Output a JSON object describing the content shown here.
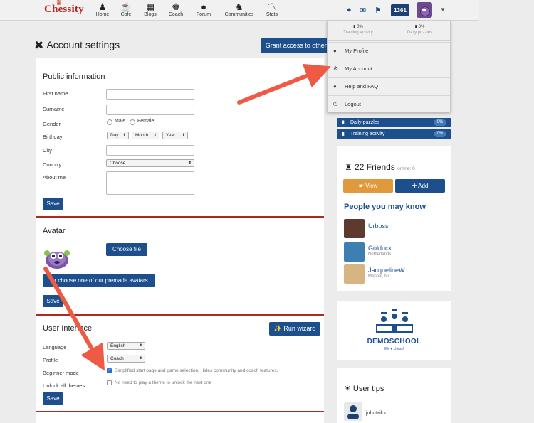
{
  "nav": {
    "logo": "Chessity",
    "items": [
      {
        "label": "Home"
      },
      {
        "label": "Cafe"
      },
      {
        "label": "Blogs"
      },
      {
        "label": "Coach"
      },
      {
        "label": "Forum"
      },
      {
        "label": "Communities"
      },
      {
        "label": "Stats"
      }
    ],
    "rating": "1361"
  },
  "page": {
    "title": "Account settings",
    "grant_button": "Grant access to other accounts"
  },
  "public_info": {
    "title": "Public information",
    "first_name_label": "First name",
    "surname_label": "Surname",
    "gender_label": "Gender",
    "gender_male": "Male",
    "gender_female": "Female",
    "birthday_label": "Birthday",
    "day": "Day",
    "month": "Month",
    "year": "Year",
    "city_label": "City",
    "country_label": "Country",
    "country_value": "Choose",
    "about_label": "About me",
    "save": "Save"
  },
  "avatar": {
    "title": "Avatar",
    "choose_file": "Choose file",
    "premade": "Or choose one of our premade avatars",
    "save": "Save"
  },
  "ui": {
    "title": "User Interface",
    "run_wizard": "Run wizard",
    "language_label": "Language",
    "language_value": "English",
    "profile_label": "Profile",
    "profile_value": "Coach",
    "beginner_label": "Beginner mode",
    "beginner_text": "Simplified start page and game selection. Hides community and coach features.",
    "beginner_checked": true,
    "unlock_label": "Unlock all themes",
    "unlock_text": "No need to play a theme to unlock the next one",
    "unlock_checked": false,
    "save": "Save"
  },
  "dropdown": {
    "training_pct": "0%",
    "training_label": "Training activity",
    "puzzles_pct": "0%",
    "puzzles_label": "Daily puzzles",
    "items": [
      {
        "label": "My Profile"
      },
      {
        "label": "My Account"
      },
      {
        "label": "Help and FAQ"
      },
      {
        "label": "Logout"
      }
    ]
  },
  "sidebar": {
    "stats": [
      {
        "label": "Daily puzzles",
        "pct": "0%"
      },
      {
        "label": "Training activity",
        "pct": "0%"
      }
    ],
    "friends_count": "22 Friends",
    "online": "online: 0",
    "view": "View",
    "add": "Add",
    "pymk_title": "People you may know",
    "people": [
      {
        "name": "Urbbss",
        "location": ""
      },
      {
        "name": "Golduck",
        "location": "Netherlands"
      },
      {
        "name": "JacquelineW",
        "location": "Meppel, NL"
      }
    ],
    "demo_title": "DEMOSCHOOL",
    "demo_sub": "We ♥ chess!",
    "tips_title": "User tips",
    "tip_user": "johntailor"
  },
  "colors": {
    "brand_blue": "#1c4f8c",
    "accent_red": "#b0281f",
    "orange": "#e09a3c",
    "arrow": "#ee5a44"
  }
}
